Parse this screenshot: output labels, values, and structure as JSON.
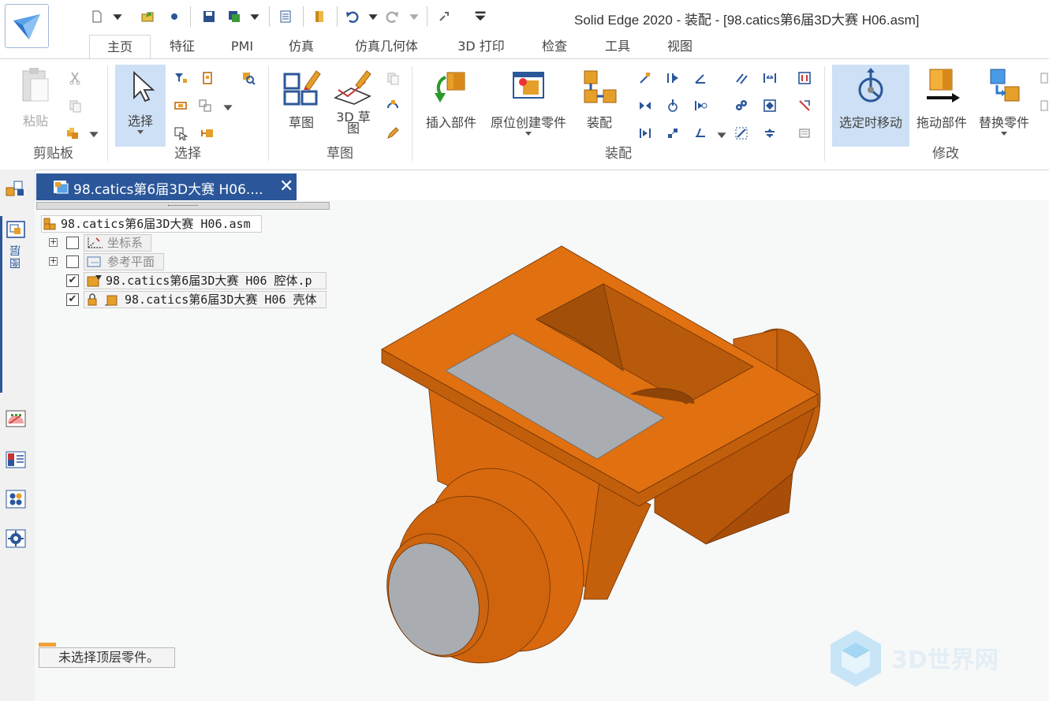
{
  "app_title": "Solid Edge 2020 - 装配 - [98.catics第6届3D大赛 H06.asm]",
  "tabs": [
    "主页",
    "特征",
    "PMI",
    "仿真",
    "仿真几何体",
    "3D 打印",
    "检查",
    "工具",
    "视图"
  ],
  "ribbon": {
    "clipboard": {
      "group": "剪贴板",
      "paste": "粘贴"
    },
    "select": {
      "group": "选择",
      "select": "选择"
    },
    "sketch": {
      "group": "草图",
      "sketch": "草图",
      "sketch3d": "3D 草图"
    },
    "assembly": {
      "group": "装配",
      "insert": "插入部件",
      "create_in_place": "原位创建零件",
      "assemble": "装配"
    },
    "modify": {
      "group": "修改",
      "move_on_select": "选定时移动",
      "drag": "拖动部件",
      "replace": "替换零件"
    }
  },
  "rail": {
    "layers_label": "图层"
  },
  "document_tab": {
    "title": "98.catics第6届3D大赛 H06...."
  },
  "tree": {
    "root": "98.catics第6届3D大赛 H06.asm",
    "items": [
      {
        "label": "坐标系",
        "checked": false
      },
      {
        "label": "参考平面",
        "checked": false
      },
      {
        "label": "98.catics第6届3D大赛 H06 腔体.p",
        "checked": true
      },
      {
        "label": "98.catics第6届3D大赛 H06 壳体",
        "checked": true
      }
    ]
  },
  "status": {
    "text": "未选择顶层零件。"
  },
  "watermark": "3D世界网",
  "colors": {
    "accent": "#2b579a",
    "part": "#d9690e",
    "part_dark": "#b8560a",
    "face": "#a9adb1",
    "highlight": "#cde0f5"
  }
}
